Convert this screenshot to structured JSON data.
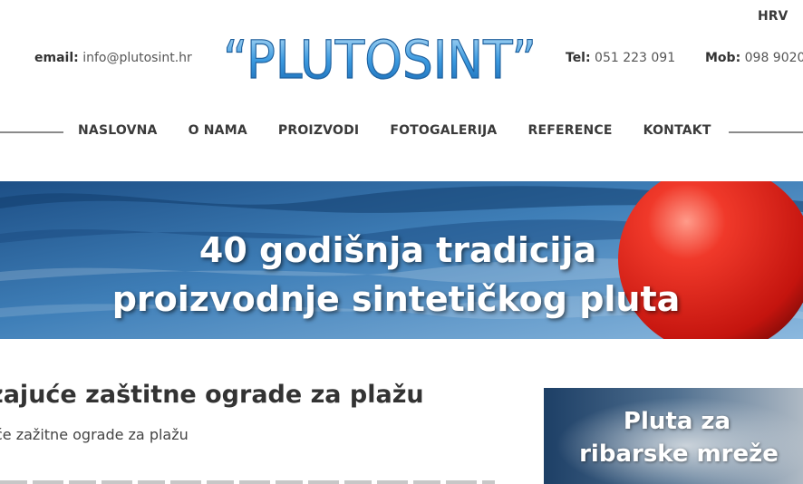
{
  "header": {
    "language": "HRV",
    "email_label": "email:",
    "email_value": "info@plutosint.hr",
    "logo_text": "“PLUTOSINT”",
    "tel_label": "Tel:",
    "tel_value": "051 223 091",
    "mob_label": "Mob:",
    "mob_value": "098 9020"
  },
  "nav": {
    "items": [
      "NASLOVNA",
      "O NAMA",
      "PROIZVODI",
      "FOTOGALERIJA",
      "REFERENCE",
      "KONTAKT"
    ]
  },
  "banner": {
    "line1": "40 godišnja tradicija",
    "line2": "proizvodnje sintetičkog pluta"
  },
  "article": {
    "title": "zajuće zaštitne ograde za plažu",
    "subtitle": "će zažitne ograde za plažu"
  },
  "sidebar": {
    "card_line1": "Pluta za",
    "card_line2": "ribarske mreže"
  },
  "colors": {
    "logo_blue": "#2a8fd8",
    "water_dark": "#1d4f86",
    "water_light": "#8bb8de",
    "buoy_red": "#e0201a"
  }
}
